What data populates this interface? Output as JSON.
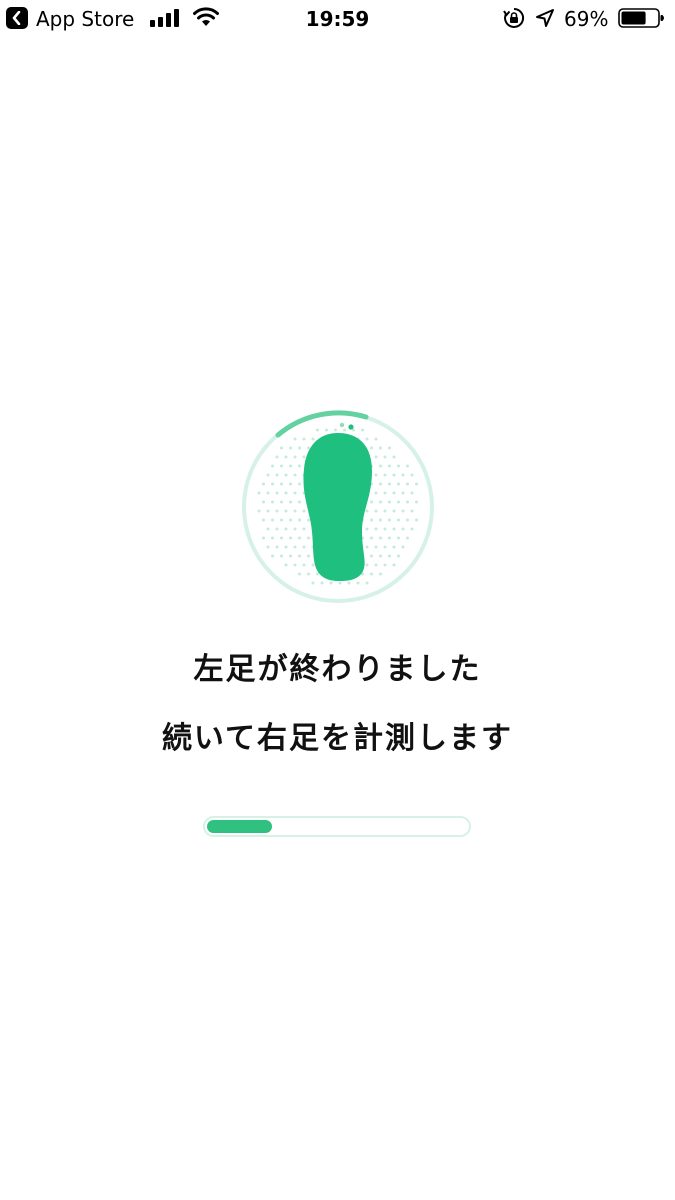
{
  "status_bar": {
    "back_app": "App Store",
    "time": "19:59",
    "battery_percent": "69%",
    "battery_level": 0.69,
    "icons": [
      "back-chevron-icon",
      "signal-icon",
      "wifi-icon",
      "orientation-lock-icon",
      "location-arrow-icon",
      "battery-icon"
    ]
  },
  "main": {
    "line1": "左足が終わりました",
    "line2": "続いて右足を計測します",
    "progress": 0.25,
    "illustration_icon": "foot-icon"
  },
  "colors": {
    "accent": "#1fbf7f",
    "accent_light": "#d6f1e5",
    "dots": "#c4ecd9"
  }
}
